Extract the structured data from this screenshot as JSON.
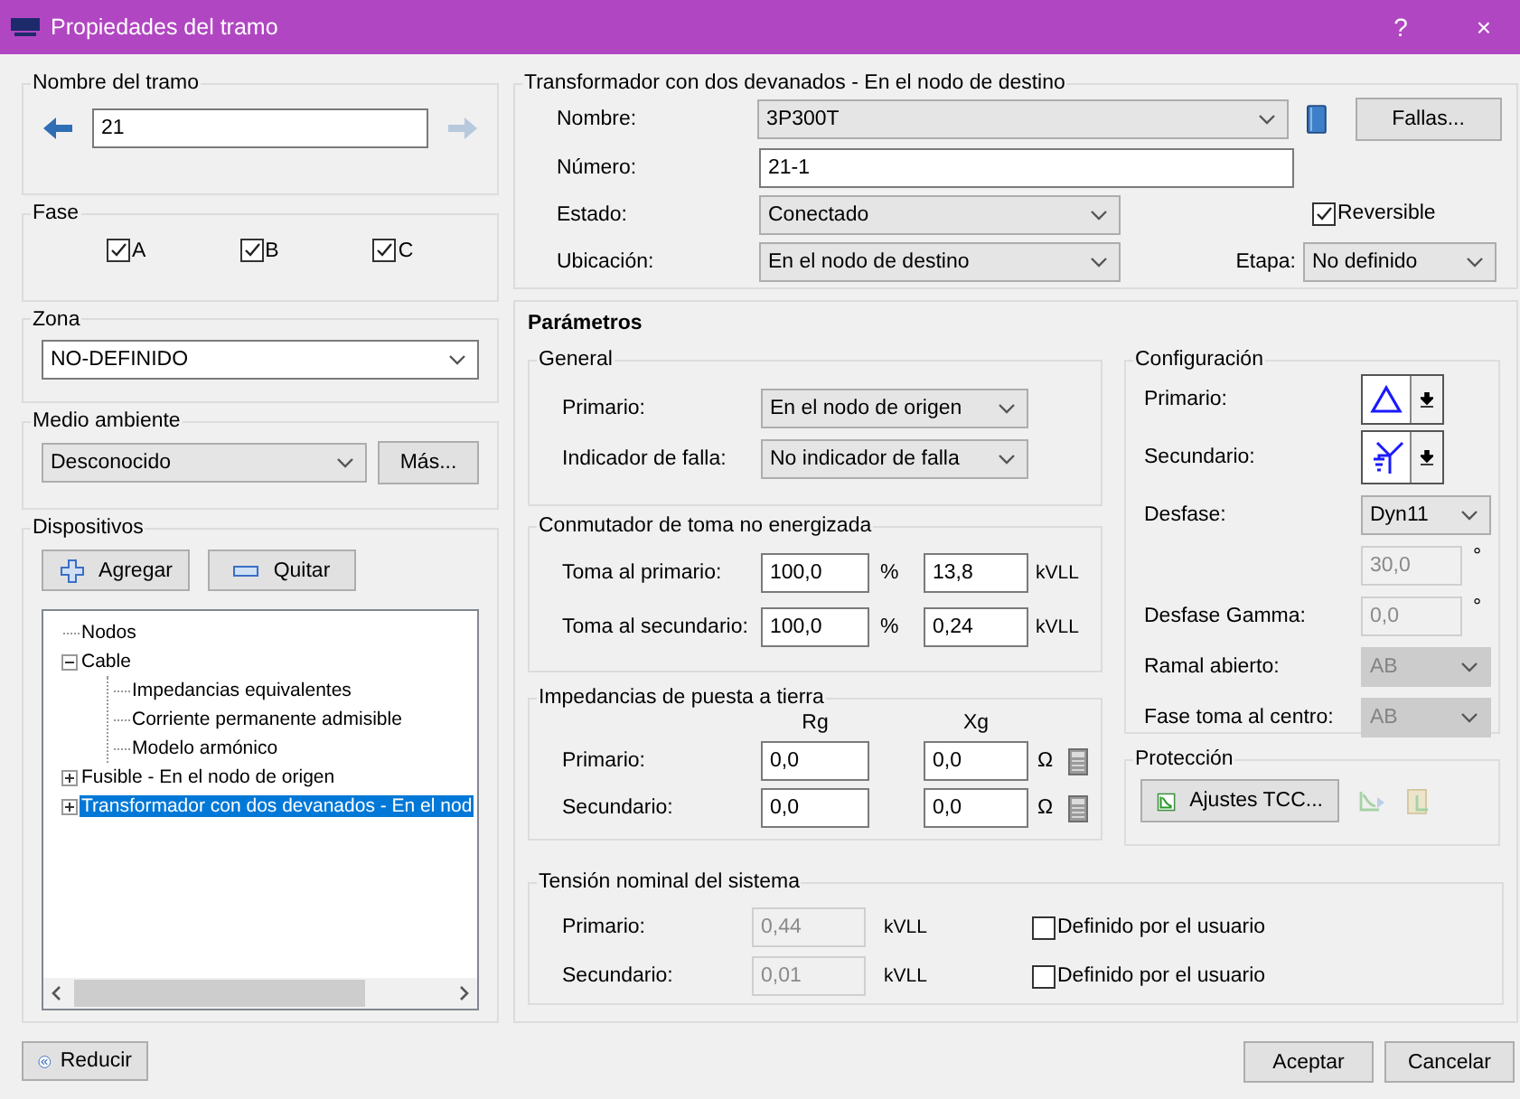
{
  "window": {
    "title": "Propiedades del tramo",
    "help": "?",
    "close": "×"
  },
  "section_name": {
    "title": "Nombre del tramo",
    "value": "21"
  },
  "phase": {
    "title": "Fase",
    "phases": [
      {
        "label": "A",
        "checked": true
      },
      {
        "label": "B",
        "checked": true
      },
      {
        "label": "C",
        "checked": true
      }
    ]
  },
  "zone": {
    "title": "Zona",
    "value": "NO-DEFINIDO"
  },
  "environment": {
    "title": "Medio ambiente",
    "value": "Desconocido",
    "button": "Más..."
  },
  "devices": {
    "title": "Dispositivos",
    "buttons": [
      {
        "label": "Agregar",
        "kind": "add"
      },
      {
        "label": "Quitar",
        "kind": "remove"
      }
    ],
    "tree": [
      {
        "label": "Nodos",
        "selected": false
      },
      {
        "label": "Cable",
        "expanded": true,
        "selected": false,
        "children": [
          {
            "label": "Impedancias equivalentes",
            "selected": false
          },
          {
            "label": "Corriente permanente admisible",
            "selected": false
          },
          {
            "label": "Modelo armónico",
            "selected": false
          }
        ]
      },
      {
        "label": "Fusible - En el nodo de origen",
        "expanded": false,
        "selected": false
      },
      {
        "label": "Transformador con dos devanados - En el nod",
        "expanded": false,
        "selected": true
      }
    ]
  },
  "collapse_button": "Reducir",
  "transformer": {
    "title": "Transformador con dos devanados - En el nodo de destino",
    "name_label": "Nombre:",
    "name": "3P300T",
    "faults_button": "Fallas...",
    "number_label": "Número:",
    "number": "21-1",
    "state_label": "Estado:",
    "state": "Conectado",
    "reversible": {
      "label": "Reversible",
      "checked": true
    },
    "location_label": "Ubicación:",
    "location": "En el nodo de destino",
    "stage_label": "Etapa:",
    "stage": "No definido"
  },
  "parameters": {
    "title": "Parámetros",
    "general": {
      "title": "General",
      "rows": [
        {
          "label": "Primario:",
          "value": "En el nodo de origen"
        },
        {
          "label": "Indicador de falla:",
          "value": "No indicador de falla"
        }
      ]
    },
    "tap_changer": {
      "title": "Conmutador de toma no energizada",
      "rows": [
        {
          "label": "Toma al primario:",
          "percent": "100,0",
          "percent_unit": "%",
          "voltage": "13,8",
          "voltage_unit": "kVLL"
        },
        {
          "label": "Toma al secundario:",
          "percent": "100,0",
          "percent_unit": "%",
          "voltage": "0,24",
          "voltage_unit": "kVLL"
        }
      ]
    },
    "grounding": {
      "title": "Impedancias de puesta a tierra",
      "columns": [
        "Rg",
        "Xg"
      ],
      "rows": [
        {
          "label": "Primario:",
          "rg": "0,0",
          "xg": "0,0",
          "unit": "Ω"
        },
        {
          "label": "Secundario:",
          "rg": "0,0",
          "xg": "0,0",
          "unit": "Ω"
        }
      ]
    },
    "configuration": {
      "title": "Configuración",
      "windings": [
        {
          "label": "Primario:",
          "kind": "delta"
        },
        {
          "label": "Secundario:",
          "kind": "wye_grounded"
        }
      ],
      "rows": [
        {
          "kind": "select",
          "label": "Desfase:",
          "value": "Dyn11",
          "disabled": false
        },
        {
          "kind": "field",
          "value": "30,0",
          "unit": "°",
          "disabled": true
        },
        {
          "kind": "field",
          "label": "Desfase Gamma:",
          "value": "0,0",
          "unit": "°",
          "disabled": true
        },
        {
          "kind": "select",
          "label": "Ramal abierto:",
          "value": "AB",
          "disabled": true
        },
        {
          "kind": "select",
          "label": "Fase toma al centro:",
          "value": "AB",
          "disabled": true
        }
      ]
    },
    "protection": {
      "title": "Protección",
      "button": "Ajustes TCC..."
    },
    "nominal_voltage": {
      "title": "Tensión nominal del sistema",
      "rows": [
        {
          "label": "Primario:",
          "value": "0,44",
          "disabled": true,
          "unit": "kVLL",
          "user_defined": {
            "label": "Definido por el usuario",
            "checked": false
          }
        },
        {
          "label": "Secundario:",
          "value": "0,01",
          "disabled": true,
          "unit": "kVLL",
          "user_defined": {
            "label": "Definido por el usuario",
            "checked": false
          }
        }
      ]
    }
  },
  "buttons": [
    {
      "label": "Aceptar"
    },
    {
      "label": "Cancelar"
    }
  ]
}
